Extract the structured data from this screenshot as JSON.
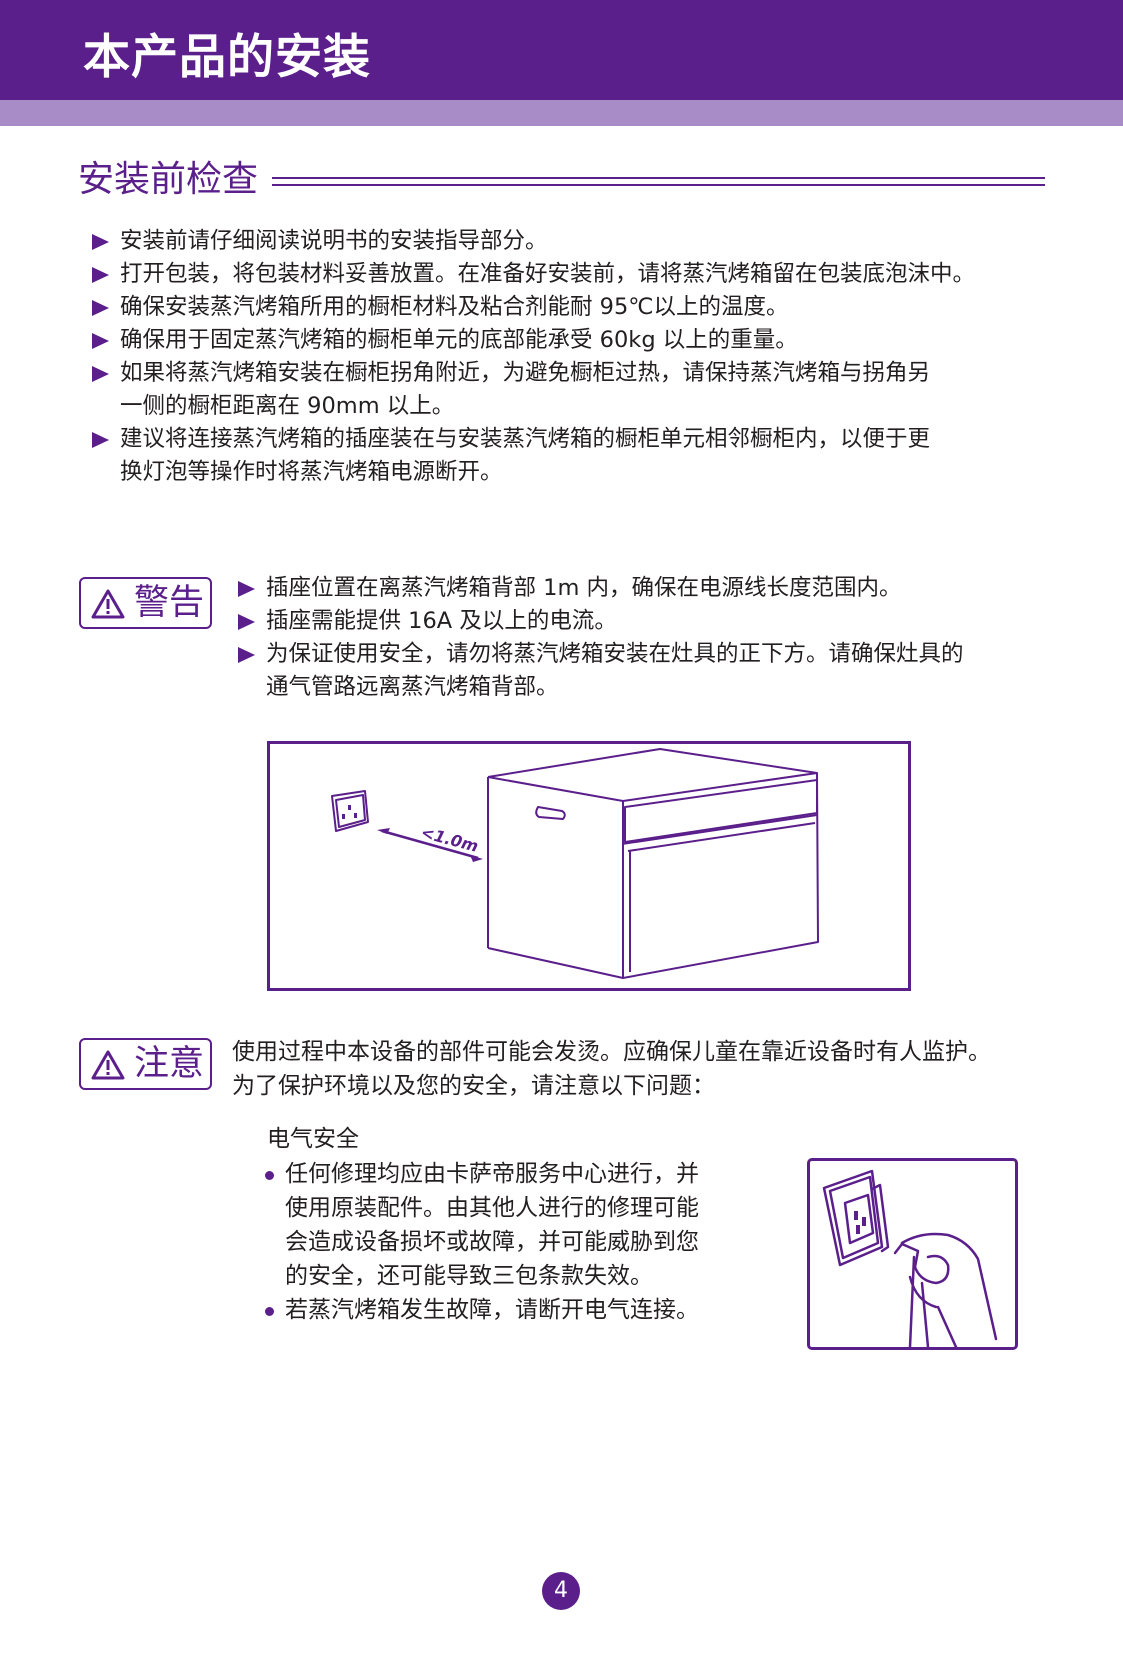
{
  "header": {
    "title": "本产品的安装"
  },
  "section": {
    "title": "安装前检查"
  },
  "checklist": [
    {
      "lines": [
        "安装前请仔细阅读说明书的安装指导部分。"
      ]
    },
    {
      "lines": [
        "打开包装，将包装材料妥善放置。在准备好安装前，请将蒸汽烤箱留在包装底泡沫中。"
      ]
    },
    {
      "lines": [
        "确保安装蒸汽烤箱所用的橱柜材料及粘合剂能耐 95℃以上的温度。"
      ]
    },
    {
      "lines": [
        "确保用于固定蒸汽烤箱的橱柜单元的底部能承受 60kg 以上的重量。"
      ]
    },
    {
      "lines": [
        "如果将蒸汽烤箱安装在橱柜拐角附近，为避免橱柜过热，请保持蒸汽烤箱与拐角另",
        "一侧的橱柜距离在 90mm 以上。"
      ]
    },
    {
      "lines": [
        "建议将连接蒸汽烤箱的插座装在与安装蒸汽烤箱的橱柜单元相邻橱柜内，以便于更",
        "换灯泡等操作时将蒸汽烤箱电源断开。"
      ]
    }
  ],
  "warning": {
    "label": "警告",
    "items": [
      {
        "lines": [
          "插座位置在离蒸汽烤箱背部 1m 内，确保在电源线长度范围内。"
        ]
      },
      {
        "lines": [
          "插座需能提供 16A 及以上的电流。"
        ]
      },
      {
        "lines": [
          "为保证使用安全，请勿将蒸汽烤箱安装在灶具的正下方。请确保灶具的",
          "通气管路远离蒸汽烤箱背部。"
        ]
      }
    ]
  },
  "diagram": {
    "distance_label": "<1.0m"
  },
  "notice": {
    "label": "注意",
    "lines": [
      "使用过程中本设备的部件可能会发烫。应确保儿童在靠近设备时有人监护。",
      "为了保护环境以及您的安全，请注意以下问题："
    ]
  },
  "electrical": {
    "title": "电气安全",
    "items": [
      {
        "lines": [
          "任何修理均应由卡萨帝服务中心进行，并",
          "使用原装配件。由其他人进行的修理可能",
          "会造成设备损坏或故障，并可能威胁到您",
          "的安全，还可能导致三包条款失效。"
        ]
      },
      {
        "lines": [
          "若蒸汽烤箱发生故障，请断开电气连接。"
        ]
      }
    ]
  },
  "page_number": "4",
  "colors": {
    "brand": "#5b1f8b",
    "band": "#a78cc7"
  }
}
